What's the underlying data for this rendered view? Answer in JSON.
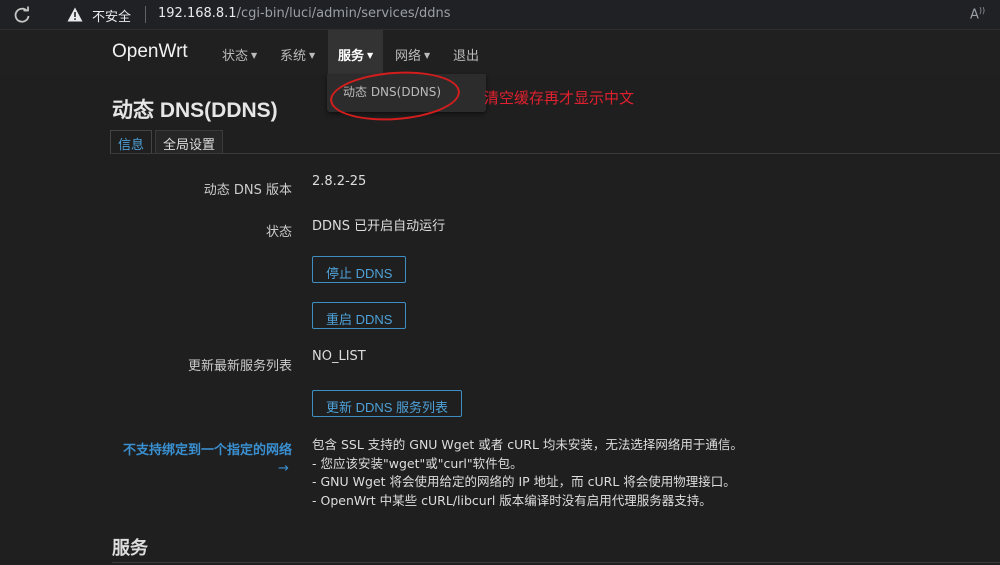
{
  "browser": {
    "insecure_label": "不安全",
    "url_host": "192.168.8.1",
    "url_path": "/cgi-bin/luci/admin/services/ddns"
  },
  "nav": {
    "brand": "OpenWrt",
    "items": [
      {
        "label": "状态",
        "has_caret": true
      },
      {
        "label": "系统",
        "has_caret": true
      },
      {
        "label": "服务",
        "has_caret": true
      },
      {
        "label": "网络",
        "has_caret": true
      },
      {
        "label": "退出",
        "has_caret": false
      }
    ]
  },
  "dropdown": {
    "items": [
      "动态 DNS(DDNS)"
    ]
  },
  "annotation": {
    "text": "清空缓存再才显示中文",
    "color": "#e0202f"
  },
  "page": {
    "title": "动态 DNS(DDNS)",
    "tabs": [
      "信息",
      "全局设置"
    ]
  },
  "info": {
    "version_label": "动态 DNS 版本",
    "version_value": "2.8.2-25",
    "status_label": "状态",
    "status_value": "DDNS 已开启自动运行",
    "stop_button": "停止 DDNS",
    "restart_button": "重启 DDNS",
    "service_list_label": "更新最新服务列表",
    "service_list_value": "NO_LIST",
    "update_list_button": "更新 DDNS 服务列表",
    "warning_label": "不支持绑定到一个指定的网络",
    "warning_arrow": "→",
    "warning_lines": [
      "包含 SSL 支持的 GNU Wget 或者 cURL 均未安装，无法选择网络用于通信。",
      "- 您应该安装\"wget\"或\"curl\"软件包。",
      "- GNU Wget 将会使用给定的网络的 IP 地址，而 cURL 将会使用物理接口。",
      "- OpenWrt 中某些 cURL/libcurl 版本编译时没有启用代理服务器支持。"
    ]
  },
  "services_section": {
    "title": "服务"
  },
  "colors": {
    "accent": "#4ea1d8",
    "background": "#1f1f1f"
  }
}
